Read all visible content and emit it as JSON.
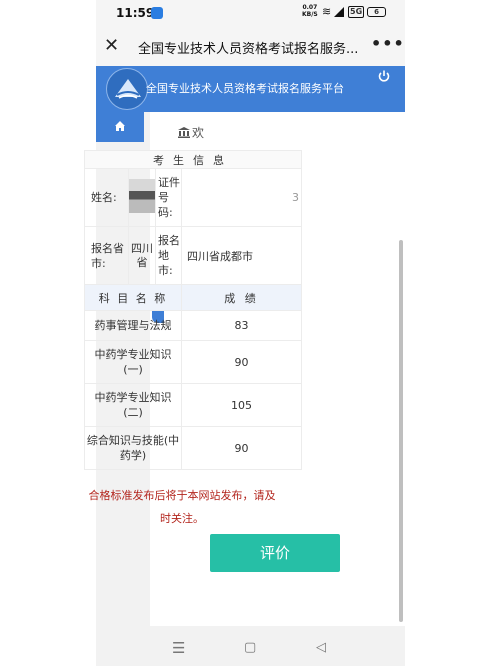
{
  "status_bar": {
    "time": "11:59",
    "net_speed": "0.07",
    "net_unit": "KB/S",
    "network": "5G",
    "battery": "6"
  },
  "browser": {
    "title": "全国专业技术人员资格考试报名服务...",
    "close_glyph": "✕",
    "more_glyph": "•••"
  },
  "site": {
    "name": "全国专业技术人员资格考试报名服务平台"
  },
  "panel": {
    "welcome": "欢"
  },
  "candidate": {
    "caption": "考生信息",
    "name_label": "姓名:",
    "id_label": "证件号码:",
    "edge_char": "3",
    "province_label": "报名省市:",
    "province_value": "四川省",
    "city_label": "报名地市:",
    "city_value": "四川省成都市"
  },
  "scores": {
    "subject_header": "科 目 名 称",
    "score_header": "成 绩",
    "rows": [
      {
        "subject": "药事管理与法规",
        "score": "83"
      },
      {
        "subject": "中药学专业知识(一)",
        "score": "90"
      },
      {
        "subject": "中药学专业知识(二)",
        "score": "105"
      },
      {
        "subject": "综合知识与技能(中药学)",
        "score": "90"
      }
    ]
  },
  "notice": "合格标准发布后将于本网站发布，请及时关注。",
  "evaluate_button": "评价",
  "colors": {
    "header_blue": "#3f7fd6",
    "button_teal": "#26bfa6",
    "notice_red": "#b3261e"
  }
}
